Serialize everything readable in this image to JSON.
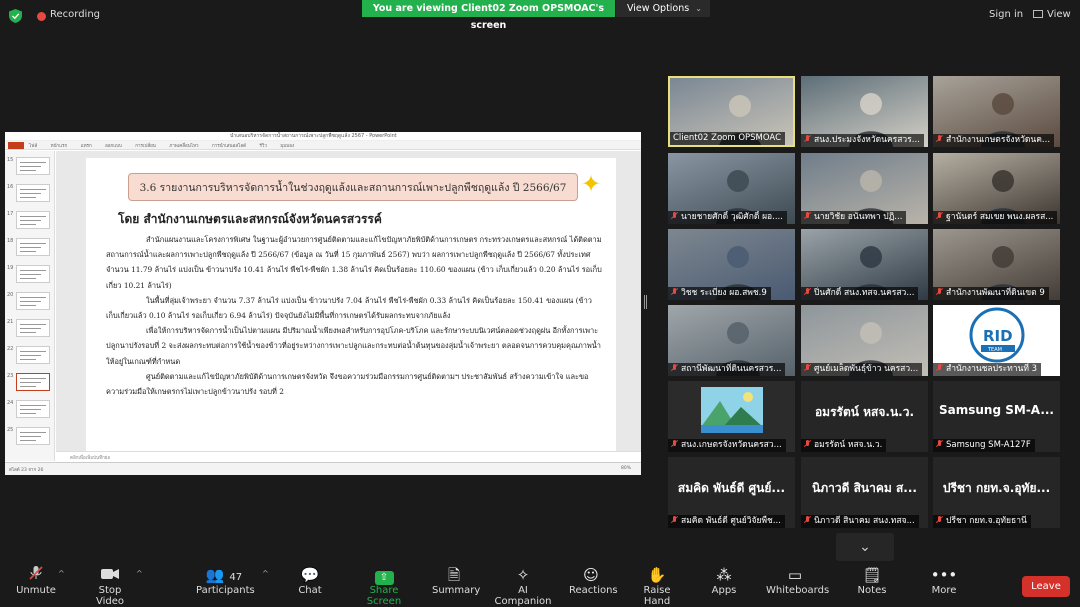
{
  "top": {
    "recording": "Recording",
    "viewing": "You are viewing Client02 Zoom OPSMOAC's screen",
    "view_options": "View Options",
    "sign_in": "Sign in",
    "view": "View"
  },
  "ppt": {
    "title": "นำเสนอบริหารจัดการน้ำสถานการณ์เพาะปลูกพืชฤดูแล้ง 2567 - PowerPoint",
    "tabs": "ไฟล์ หน้าแรก แทรก ออกแบบ การเปลี่ยน ภาพเคลื่อนไหว การนำเสนอสไลด์ รีวิว มุมมอง",
    "thumb_numbers": [
      "15",
      "16",
      "17",
      "18",
      "19",
      "20",
      "21",
      "22",
      "23",
      "24",
      "25"
    ],
    "notes_placeholder": "คลิกเพื่อเพิ่มบันทึกย่อ",
    "status_left": "สไลด์ 23 จาก 26",
    "status_zoom": "80%"
  },
  "slide": {
    "banner": "3.6 รายงานการบริหารจัดการน้ำในช่วงฤดูแล้งและสถานการณ์เพาะปลูกพืชฤดูแล้ง ปี 2566/67",
    "org": "โดย สำนักงานเกษตรและสหกรณ์จังหวัดนครสวรรค์",
    "p1": "สำนักแผนงานและโครงการพิเศษ ในฐานะผู้อำนวยการศูนย์ติดตามและแก้ไขปัญหาภัยพิบัติด้านการเกษตร กระทรวงเกษตรและสหกรณ์ ได้ติดตามสถานการณ์น้ำและผลการเพาะปลูกพืชฤดูแล้ง ปี 2566/67 (ข้อมูล ณ วันที่ 15 กุมภาพันธ์ 2567) พบว่า ผลการเพาะปลูกพืชฤดูแล้ง ปี 2566/67 ทั้งประเทศ จำนวน 11.79 ล้านไร่ แบ่งเป็น ข้าวนาปรัง 10.41 ล้านไร่ พืชไร่-พืชผัก 1.38 ล้านไร่ คิดเป็นร้อยละ 110.60 ของแผน (ข้าว เก็บเกี่ยวแล้ว 0.20 ล้านไร่ รอเก็บเกี่ยว 10.21 ล้านไร่)",
    "p2": "ในพื้นที่ลุ่มเจ้าพระยา จำนวน 7.37 ล้านไร่ แบ่งเป็น ข้าวนาปรัง 7.04 ล้านไร่ พืชไร่-พืชผัก 0.33 ล้านไร่ คิดเป็นร้อยละ 150.41 ของแผน (ข้าว เก็บเกี่ยวแล้ว 0.10 ล้านไร่ รอเก็บเกี่ยว 6.94 ล้านไร่) ปัจจุบันยังไม่มีพื้นที่การเกษตรได้รับผลกระทบจากภัยแล้ง",
    "p3": "เพื่อให้การบริหารจัดการน้ำเป็นไปตามแผน มีปริมาณน้ำเพียงพอสำหรับการอุปโภค-บริโภค และรักษาระบบนิเวศน์ตลอดช่วงฤดูฝน อีกทั้งการเพาะปลูกนาปรังรอบที่ 2 จะส่งผลกระทบต่อการใช้น้ำของข้าวที่อยู่ระหว่างการเพาะปลูกและกระทบต่อน้ำต้นทุนของลุ่มน้ำเจ้าพระยา ตลอดจนการควบคุมคุณภาพน้ำให้อยู่ในเกณฑ์ที่กำหนด",
    "p4": "ศูนย์ติดตามและแก้ไขปัญหาภัยพิบัติด้านการเกษตรจังหวัด จึงขอความร่วมมือกรรมการศูนย์ติดตามฯ ประชาสัมพันธ์ สร้างความเข้าใจ และขอความร่วมมือให้เกษตรกรไม่เพาะปลูกข้าวนาปรัง รอบที่ 2"
  },
  "gallery": [
    {
      "name": "Client02 Zoom OPSMOAC",
      "big": "",
      "muted": false
    },
    {
      "name": "สนง.ประมงจังหวัดนครสวร...",
      "big": "",
      "muted": true
    },
    {
      "name": "สำนักงานเกษตรจังหวัดนค...",
      "big": "",
      "muted": true
    },
    {
      "name": "นายชายศักดิ์ วุฒิศักดิ์ ผอ....",
      "big": "",
      "muted": true
    },
    {
      "name": "นายวิชัย อนันทพา ปฏิ...",
      "big": "",
      "muted": true
    },
    {
      "name": "ฐานันดร์ สมเขย พนง.ผลรส...",
      "big": "",
      "muted": true
    },
    {
      "name": "วิชช ระเบียง ผอ.สพช.9",
      "big": "",
      "muted": true
    },
    {
      "name": "ปิ่นศักดิ์ สนง.ทสจ.นครสว...",
      "big": "",
      "muted": true
    },
    {
      "name": "สำนักงานพัฒนาที่ดินเขต 9",
      "big": "",
      "muted": true
    },
    {
      "name": "สถานีพัฒนาที่ดินนครสวร...",
      "big": "",
      "muted": true
    },
    {
      "name": "ศูนย์เมล็ดพันธุ์ข้าว นครสว...",
      "big": "",
      "muted": true
    },
    {
      "name": "สำนักงานชลประทานที่ 3",
      "big": "",
      "muted": true
    },
    {
      "name": "สนง.เกษตรจังหวัดนครสว...",
      "big": "",
      "muted": true
    },
    {
      "name": "อมรรัตน์ หสจ.น.ว.",
      "big": "อมรรัตน์ หสจ.น.ว.",
      "muted": true
    },
    {
      "name": "Samsung SM-A127F",
      "big": "Samsung SM-A...",
      "muted": true
    },
    {
      "name": "สมคิด พันธ์ดี ศูนย์วิจัยพืช...",
      "big": "สมคิด พันธ์ดี ศูนย์...",
      "muted": true
    },
    {
      "name": "นิภาวดี สินาคม สนง.ทสจ...",
      "big": "นิภาวดี สินาคม ส...",
      "muted": true
    },
    {
      "name": "ปรีชา กยท.จ.อุทัยธานี",
      "big": "ปรีชา กยท.จ.อุทัย...",
      "muted": true
    }
  ],
  "toolbar": {
    "unmute": "Unmute",
    "stop_video": "Stop Video",
    "participants": "Participants",
    "participants_count": "47",
    "chat": "Chat",
    "share_screen": "Share Screen",
    "summary": "Summary",
    "ai": "AI Companion",
    "reactions": "Reactions",
    "raise_hand": "Raise Hand",
    "apps": "Apps",
    "whiteboards": "Whiteboards",
    "notes": "Notes",
    "more": "More",
    "leave": "Leave"
  },
  "colors": {
    "share_green": "#23b14d",
    "leave_red": "#d4312b",
    "active_border": "#e8e07a"
  }
}
